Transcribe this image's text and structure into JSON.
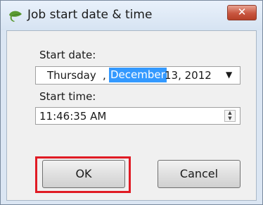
{
  "window": {
    "title": "Job start date & time",
    "close_glyph": "✕",
    "app_icon": "leaf-icon"
  },
  "start_date": {
    "label": "Start date:",
    "day": "Thursday",
    "separator": ",",
    "month": "December",
    "rest": "13, 2012",
    "dropdown_glyph": "▼"
  },
  "start_time": {
    "label": "Start time:",
    "value": "11:46:35 AM",
    "up_glyph": "▲",
    "down_glyph": "▼"
  },
  "buttons": {
    "ok": "OK",
    "cancel": "Cancel"
  },
  "colors": {
    "selection": "#3399ff",
    "highlight": "#e01b24",
    "close": "#c8553f"
  }
}
